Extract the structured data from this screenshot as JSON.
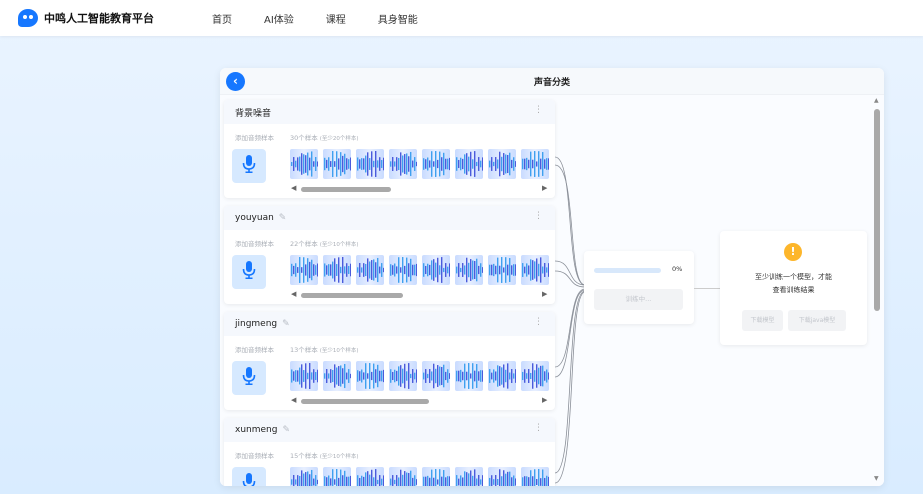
{
  "brand": {
    "name": "中鸣人工智能教育平台"
  },
  "nav": [
    {
      "label": "首页"
    },
    {
      "label": "AI体验"
    },
    {
      "label": "课程"
    },
    {
      "label": "具身智能"
    }
  ],
  "panel": {
    "title": "声音分类",
    "back_icon": "chevron-left-icon"
  },
  "colors": {
    "accent": "#1677ff",
    "warning": "#fdb62b",
    "mic_bg": "#d6e9ff"
  },
  "classes": [
    {
      "name": "背景噪音",
      "add_label": "添加音频样本",
      "count": "30个样本",
      "hint": "(至少20个样本)",
      "editable": false,
      "scroll": 0.2
    },
    {
      "name": "youyuan",
      "add_label": "添加音频样本",
      "count": "22个样本",
      "hint": "(至少10个样本)",
      "editable": true,
      "scroll": 0.28
    },
    {
      "name": "jingmeng",
      "add_label": "添加音频样本",
      "count": "13个样本",
      "hint": "(至少10个样本)",
      "editable": true,
      "scroll": 0.45
    },
    {
      "name": "xunmeng",
      "add_label": "添加音频样本",
      "count": "15个样本",
      "hint": "(至少10个样本)",
      "editable": true,
      "scroll": 0.3
    }
  ],
  "training": {
    "progress": 0,
    "progress_label": "0%",
    "button_label": "训练中..."
  },
  "result": {
    "icon": "warning-icon",
    "message_line1": "至少训练一个模型，才能",
    "message_line2": "查看训练结果",
    "download_model": "下载模型",
    "download_java": "下载java模型"
  }
}
